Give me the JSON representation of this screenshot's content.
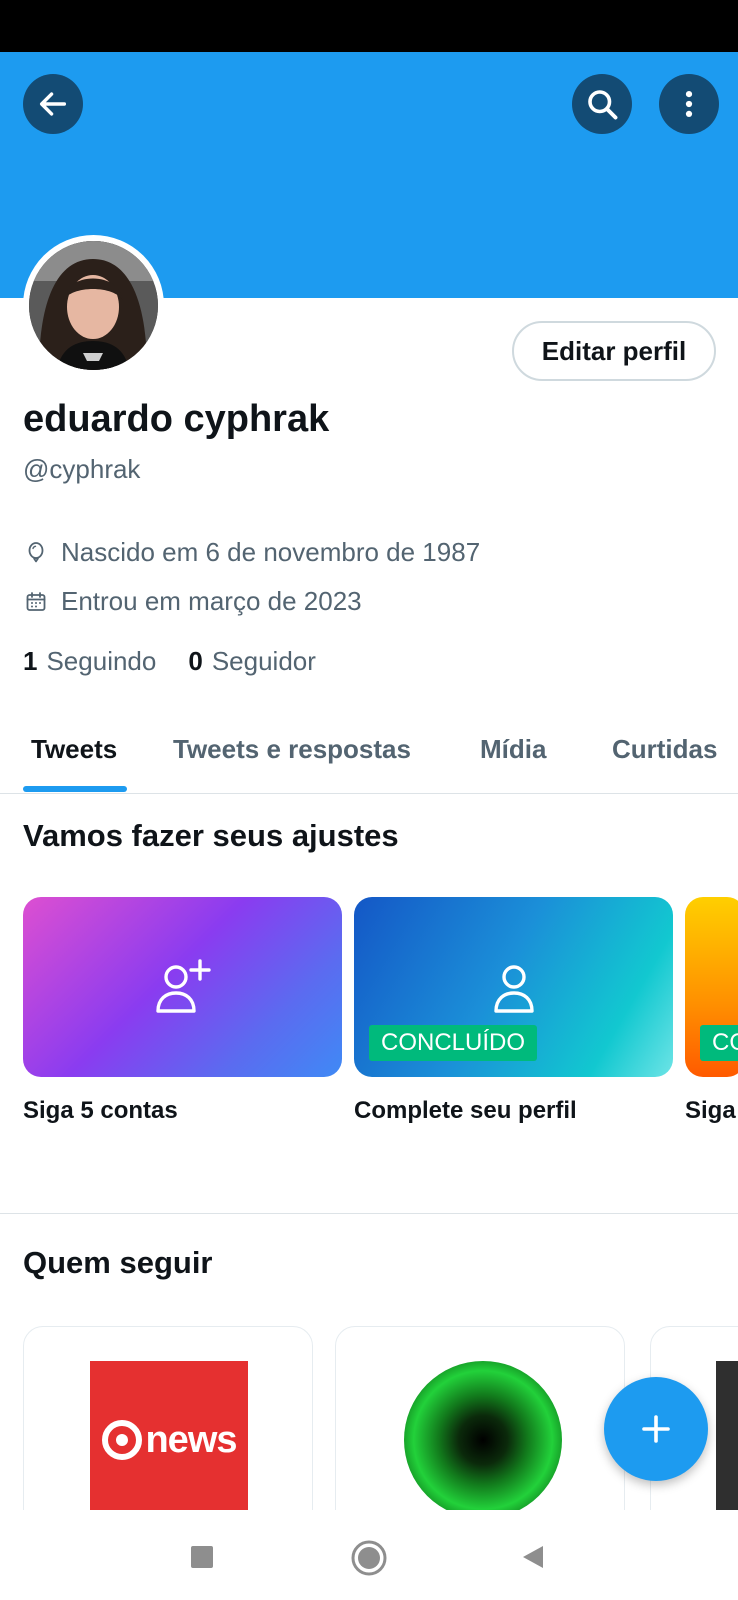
{
  "colors": {
    "accent": "#1d9bf0",
    "success": "#00ba7c",
    "text": "#0f1419",
    "muted": "#536471"
  },
  "header": {
    "back_icon": "arrow-left-icon",
    "search_icon": "search-icon",
    "more_icon": "more-vertical-icon"
  },
  "profile": {
    "edit_label": "Editar perfil",
    "name": "eduardo cyphrak",
    "handle": "@cyphrak",
    "birth_icon": "balloon-icon",
    "birth": "Nascido em 6 de novembro de 1987",
    "joined_icon": "calendar-icon",
    "joined": "Entrou em março de 2023",
    "following_count": "1",
    "following_label": "Seguindo",
    "followers_count": "0",
    "followers_label": "Seguidor"
  },
  "tabs": [
    {
      "label": "Tweets",
      "active": true
    },
    {
      "label": "Tweets e respostas",
      "active": false
    },
    {
      "label": "Mídia",
      "active": false
    },
    {
      "label": "Curtidas",
      "active": false
    }
  ],
  "setup": {
    "title": "Vamos fazer seus ajustes",
    "cards": [
      {
        "label": "Siga 5 contas",
        "icon": "person-add-icon",
        "badge": ""
      },
      {
        "label": "Complete seu perfil",
        "icon": "person-icon",
        "badge": "CONCLUÍDO"
      },
      {
        "label": "Siga",
        "icon": "",
        "badge": "CO"
      }
    ]
  },
  "who_to_follow": {
    "title": "Quem seguir",
    "cards": [
      {
        "logo_text": "news",
        "logo_icon": "globo-news-logo"
      },
      {
        "logo_icon": "green-eye-avatar"
      },
      {
        "logo_icon": "dark-avatar"
      }
    ]
  },
  "fab": {
    "icon": "plus-icon"
  },
  "system_nav": {
    "recents_icon": "square-icon",
    "home_icon": "circle-icon",
    "back_icon": "triangle-back-icon"
  }
}
